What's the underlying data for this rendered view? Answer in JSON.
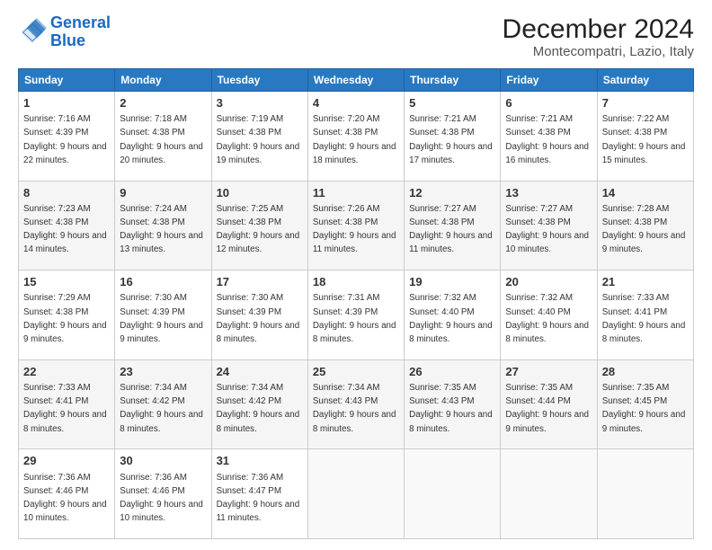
{
  "logo": {
    "line1": "General",
    "line2": "Blue"
  },
  "title": "December 2024",
  "subtitle": "Montecompatri, Lazio, Italy",
  "days_header": [
    "Sunday",
    "Monday",
    "Tuesday",
    "Wednesday",
    "Thursday",
    "Friday",
    "Saturday"
  ],
  "weeks": [
    [
      {
        "day": "1",
        "sunrise": "Sunrise: 7:16 AM",
        "sunset": "Sunset: 4:39 PM",
        "daylight": "Daylight: 9 hours and 22 minutes."
      },
      {
        "day": "2",
        "sunrise": "Sunrise: 7:18 AM",
        "sunset": "Sunset: 4:38 PM",
        "daylight": "Daylight: 9 hours and 20 minutes."
      },
      {
        "day": "3",
        "sunrise": "Sunrise: 7:19 AM",
        "sunset": "Sunset: 4:38 PM",
        "daylight": "Daylight: 9 hours and 19 minutes."
      },
      {
        "day": "4",
        "sunrise": "Sunrise: 7:20 AM",
        "sunset": "Sunset: 4:38 PM",
        "daylight": "Daylight: 9 hours and 18 minutes."
      },
      {
        "day": "5",
        "sunrise": "Sunrise: 7:21 AM",
        "sunset": "Sunset: 4:38 PM",
        "daylight": "Daylight: 9 hours and 17 minutes."
      },
      {
        "day": "6",
        "sunrise": "Sunrise: 7:21 AM",
        "sunset": "Sunset: 4:38 PM",
        "daylight": "Daylight: 9 hours and 16 minutes."
      },
      {
        "day": "7",
        "sunrise": "Sunrise: 7:22 AM",
        "sunset": "Sunset: 4:38 PM",
        "daylight": "Daylight: 9 hours and 15 minutes."
      }
    ],
    [
      {
        "day": "8",
        "sunrise": "Sunrise: 7:23 AM",
        "sunset": "Sunset: 4:38 PM",
        "daylight": "Daylight: 9 hours and 14 minutes."
      },
      {
        "day": "9",
        "sunrise": "Sunrise: 7:24 AM",
        "sunset": "Sunset: 4:38 PM",
        "daylight": "Daylight: 9 hours and 13 minutes."
      },
      {
        "day": "10",
        "sunrise": "Sunrise: 7:25 AM",
        "sunset": "Sunset: 4:38 PM",
        "daylight": "Daylight: 9 hours and 12 minutes."
      },
      {
        "day": "11",
        "sunrise": "Sunrise: 7:26 AM",
        "sunset": "Sunset: 4:38 PM",
        "daylight": "Daylight: 9 hours and 11 minutes."
      },
      {
        "day": "12",
        "sunrise": "Sunrise: 7:27 AM",
        "sunset": "Sunset: 4:38 PM",
        "daylight": "Daylight: 9 hours and 11 minutes."
      },
      {
        "day": "13",
        "sunrise": "Sunrise: 7:27 AM",
        "sunset": "Sunset: 4:38 PM",
        "daylight": "Daylight: 9 hours and 10 minutes."
      },
      {
        "day": "14",
        "sunrise": "Sunrise: 7:28 AM",
        "sunset": "Sunset: 4:38 PM",
        "daylight": "Daylight: 9 hours and 9 minutes."
      }
    ],
    [
      {
        "day": "15",
        "sunrise": "Sunrise: 7:29 AM",
        "sunset": "Sunset: 4:38 PM",
        "daylight": "Daylight: 9 hours and 9 minutes."
      },
      {
        "day": "16",
        "sunrise": "Sunrise: 7:30 AM",
        "sunset": "Sunset: 4:39 PM",
        "daylight": "Daylight: 9 hours and 9 minutes."
      },
      {
        "day": "17",
        "sunrise": "Sunrise: 7:30 AM",
        "sunset": "Sunset: 4:39 PM",
        "daylight": "Daylight: 9 hours and 8 minutes."
      },
      {
        "day": "18",
        "sunrise": "Sunrise: 7:31 AM",
        "sunset": "Sunset: 4:39 PM",
        "daylight": "Daylight: 9 hours and 8 minutes."
      },
      {
        "day": "19",
        "sunrise": "Sunrise: 7:32 AM",
        "sunset": "Sunset: 4:40 PM",
        "daylight": "Daylight: 9 hours and 8 minutes."
      },
      {
        "day": "20",
        "sunrise": "Sunrise: 7:32 AM",
        "sunset": "Sunset: 4:40 PM",
        "daylight": "Daylight: 9 hours and 8 minutes."
      },
      {
        "day": "21",
        "sunrise": "Sunrise: 7:33 AM",
        "sunset": "Sunset: 4:41 PM",
        "daylight": "Daylight: 9 hours and 8 minutes."
      }
    ],
    [
      {
        "day": "22",
        "sunrise": "Sunrise: 7:33 AM",
        "sunset": "Sunset: 4:41 PM",
        "daylight": "Daylight: 9 hours and 8 minutes."
      },
      {
        "day": "23",
        "sunrise": "Sunrise: 7:34 AM",
        "sunset": "Sunset: 4:42 PM",
        "daylight": "Daylight: 9 hours and 8 minutes."
      },
      {
        "day": "24",
        "sunrise": "Sunrise: 7:34 AM",
        "sunset": "Sunset: 4:42 PM",
        "daylight": "Daylight: 9 hours and 8 minutes."
      },
      {
        "day": "25",
        "sunrise": "Sunrise: 7:34 AM",
        "sunset": "Sunset: 4:43 PM",
        "daylight": "Daylight: 9 hours and 8 minutes."
      },
      {
        "day": "26",
        "sunrise": "Sunrise: 7:35 AM",
        "sunset": "Sunset: 4:43 PM",
        "daylight": "Daylight: 9 hours and 8 minutes."
      },
      {
        "day": "27",
        "sunrise": "Sunrise: 7:35 AM",
        "sunset": "Sunset: 4:44 PM",
        "daylight": "Daylight: 9 hours and 9 minutes."
      },
      {
        "day": "28",
        "sunrise": "Sunrise: 7:35 AM",
        "sunset": "Sunset: 4:45 PM",
        "daylight": "Daylight: 9 hours and 9 minutes."
      }
    ],
    [
      {
        "day": "29",
        "sunrise": "Sunrise: 7:36 AM",
        "sunset": "Sunset: 4:46 PM",
        "daylight": "Daylight: 9 hours and 10 minutes."
      },
      {
        "day": "30",
        "sunrise": "Sunrise: 7:36 AM",
        "sunset": "Sunset: 4:46 PM",
        "daylight": "Daylight: 9 hours and 10 minutes."
      },
      {
        "day": "31",
        "sunrise": "Sunrise: 7:36 AM",
        "sunset": "Sunset: 4:47 PM",
        "daylight": "Daylight: 9 hours and 11 minutes."
      },
      null,
      null,
      null,
      null
    ]
  ]
}
